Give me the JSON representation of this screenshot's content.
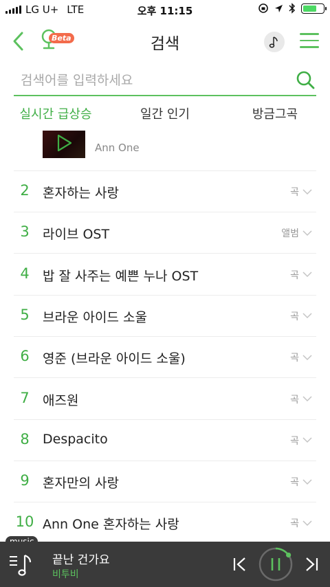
{
  "status_bar": {
    "carrier": "LG U+",
    "network": "LTE",
    "time": "오후 11:15"
  },
  "header": {
    "title": "검색",
    "beta_label": "Beta"
  },
  "search": {
    "placeholder": "검색어를 입력하세요",
    "value": ""
  },
  "tabs": [
    {
      "label": "실시간 급상승",
      "active": true
    },
    {
      "label": "일간 인기",
      "active": false
    },
    {
      "label": "방금그곡",
      "active": false
    }
  ],
  "top_item": {
    "subtitle": "Ann One"
  },
  "results": [
    {
      "rank": "2",
      "title": "혼자하는 사랑",
      "type": "곡"
    },
    {
      "rank": "3",
      "title": "라이브 OST",
      "type": "앨범"
    },
    {
      "rank": "4",
      "title": "밥 잘 사주는 예쁜 누나 OST",
      "type": "곡"
    },
    {
      "rank": "5",
      "title": "브라운 아이드 소울",
      "type": "곡"
    },
    {
      "rank": "6",
      "title": "영준 (브라운 아이드 소울)",
      "type": "곡"
    },
    {
      "rank": "7",
      "title": "애즈원",
      "type": "곡"
    },
    {
      "rank": "8",
      "title": "Despacito",
      "type": "곡"
    },
    {
      "rank": "9",
      "title": "혼자만의 사랑",
      "type": "곡"
    },
    {
      "rank": "10",
      "title": "Ann One 혼자하는 사랑",
      "type": "곡"
    }
  ],
  "player": {
    "tag": "music",
    "title": "끝난 건가요",
    "artist": "비투비",
    "progress": 0.15
  },
  "colors": {
    "accent": "#3fae45",
    "player_bg": "#3a3a3a",
    "beta": "#f36b4b"
  },
  "icons": [
    "back-chevron-icon",
    "mic-logo-icon",
    "music-note-icon",
    "hamburger-menu-icon",
    "search-icon",
    "chevron-down-icon",
    "playlist-icon",
    "previous-icon",
    "pause-icon",
    "next-icon"
  ]
}
